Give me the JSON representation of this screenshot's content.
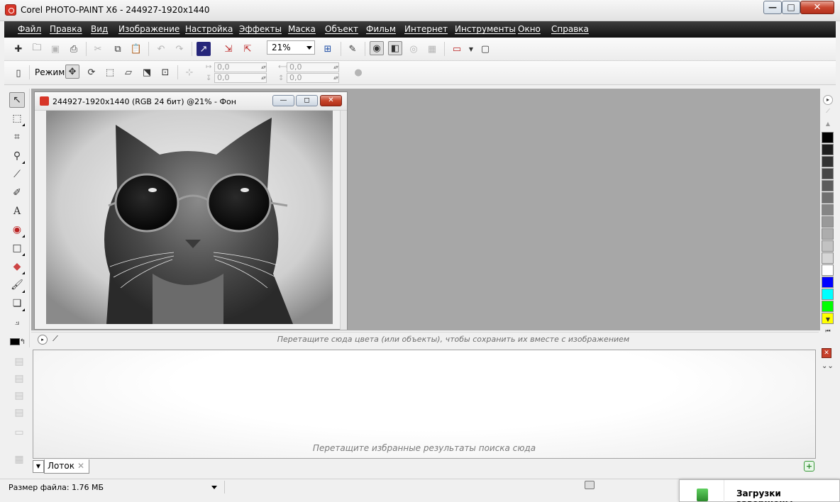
{
  "window": {
    "title": "Corel PHOTO-PAINT X6 - 244927-1920x1440",
    "controls": {
      "minimize": "—",
      "maximize": "□",
      "close": "✕"
    }
  },
  "menu": [
    "Файл",
    "Правка",
    "Вид",
    "Изображение",
    "Настройка",
    "Эффекты",
    "Маска",
    "Объект",
    "Фильм",
    "Интернет",
    "Инструменты",
    "Окно",
    "Справка"
  ],
  "toolbar": {
    "zoom_value": "21%"
  },
  "property_bar": {
    "mode_label": "Режим",
    "offset_x": "0,0",
    "offset_y": "0,0",
    "size_x": "0,0",
    "size_y": "0,0"
  },
  "document": {
    "title": "244927-1920x1440 (RGB 24 бит) @21% - Фон"
  },
  "color_strip": {
    "hint": "Перетащите сюда цвета (или объекты), чтобы сохранить их вместе с изображением"
  },
  "palette": {
    "colors": [
      "#000000",
      "#1e1e1e",
      "#333333",
      "#474747",
      "#5c5c5c",
      "#707070",
      "#858585",
      "#999999",
      "#adadad",
      "#c2c2c2",
      "#d6d6d6",
      "#ffffff",
      "#0000ff",
      "#00ffff",
      "#00ff00",
      "#ffff00"
    ]
  },
  "tray": {
    "hint": "Перетащите избранные результаты поиска сюда",
    "tab_label": "Лоток",
    "tab_close": "✕",
    "add": "+"
  },
  "status": {
    "text": "Размер файла:  1.76 МБ"
  },
  "download_popup": {
    "text": "Загрузки завершены"
  },
  "colors": {
    "menubar": "#1f1f1f",
    "workspace": "#a7a7a7",
    "close_red": "#c8462f"
  }
}
